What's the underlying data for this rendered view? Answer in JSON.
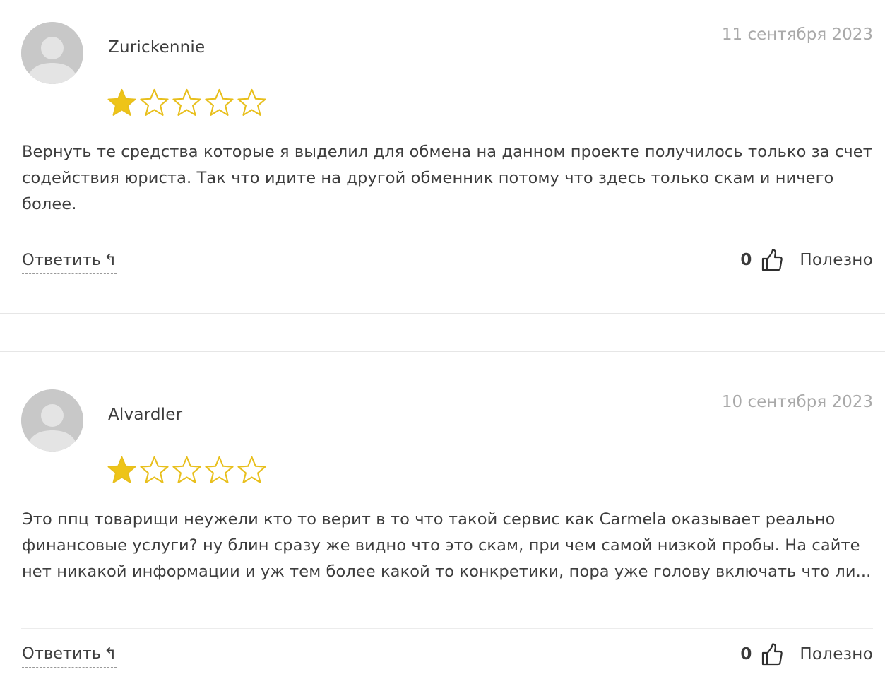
{
  "reviews": [
    {
      "author": "Zurickennie",
      "date": "11 сентября 2023",
      "rating": 1,
      "rating_max": 5,
      "text": "Вернуть те средства которые я выделил для обмена на данном проекте получилось только за счет содействия юриста. Так что идите на другой обменник потому что здесь только скам и ничего более.",
      "reply_label": "Ответить",
      "reply_icon": "↰",
      "likes": "0",
      "helpful_label": "Полезно"
    },
    {
      "author": "Alvardler",
      "date": "10 сентября 2023",
      "rating": 1,
      "rating_max": 5,
      "text": "Это ппц товарищи неужели кто то верит в то что такой сервис как Carmela оказывает реально финансовые услуги? ну блин сразу же видно что это скам, при чем самой низкой пробы. На сайте нет никакой информации и уж тем более какой то конкретики, пора уже голову включать что ли...",
      "reply_label": "Ответить",
      "reply_icon": "↰",
      "likes": "0",
      "helpful_label": "Полезно"
    }
  ],
  "colors": {
    "star_fill": "#eec418",
    "star_outline": "#e8bf1c",
    "avatar_bg": "#c8c8c8",
    "avatar_fg": "#e4e4e4"
  },
  "icons": {
    "avatar": "default-user-avatar-icon",
    "star_filled": "star-filled-icon",
    "star_empty": "star-empty-icon",
    "thumb": "thumbs-up-icon",
    "reply": "reply-arrow-icon"
  }
}
